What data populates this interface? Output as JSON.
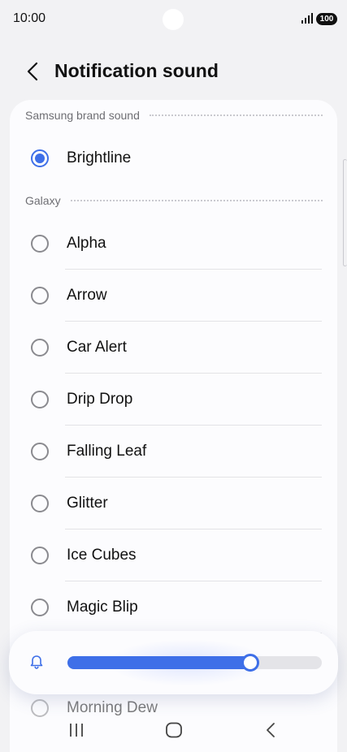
{
  "status_bar": {
    "time": "10:00",
    "battery": "100"
  },
  "header": {
    "title": "Notification sound"
  },
  "sections": [
    {
      "label": "Samsung brand sound",
      "options": [
        {
          "label": "Brightline",
          "selected": true
        }
      ]
    },
    {
      "label": "Galaxy",
      "options": [
        {
          "label": "Alpha",
          "selected": false
        },
        {
          "label": "Arrow",
          "selected": false
        },
        {
          "label": "Car Alert",
          "selected": false
        },
        {
          "label": "Drip Drop",
          "selected": false
        },
        {
          "label": "Falling Leaf",
          "selected": false
        },
        {
          "label": "Glitter",
          "selected": false
        },
        {
          "label": "Ice Cubes",
          "selected": false
        },
        {
          "label": "Magic Blip",
          "selected": false
        },
        {
          "label": "Morning Dew",
          "selected": false
        }
      ]
    }
  ],
  "volume": {
    "level": 0.72,
    "icon": "bell-icon"
  },
  "colors": {
    "accent": "#3e6fe8",
    "background": "#f2f2f4",
    "card": "#fcfcfe"
  }
}
